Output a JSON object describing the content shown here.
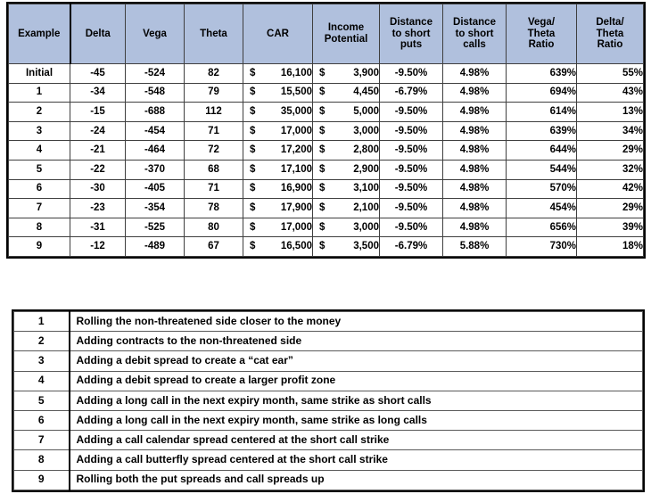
{
  "metrics_table": {
    "headers": [
      "Example",
      "Delta",
      "Vega",
      "Theta",
      "CAR",
      "Income Potential",
      "Distance to short puts",
      "Distance to short calls",
      "Vega/ Theta Ratio",
      "Delta/ Theta Ratio"
    ],
    "header_lines": {
      "example": [
        "Example"
      ],
      "delta": [
        "Delta"
      ],
      "vega": [
        "Vega"
      ],
      "theta": [
        "Theta"
      ],
      "car": [
        "CAR"
      ],
      "income": [
        "Income",
        "Potential"
      ],
      "dist_short_puts": [
        "Distance",
        "to short",
        "puts"
      ],
      "dist_short_calls": [
        "Distance",
        "to short",
        "calls"
      ],
      "vega_theta": [
        "Vega/",
        "Theta",
        "Ratio"
      ],
      "delta_theta": [
        "Delta/",
        "Theta",
        "Ratio"
      ]
    },
    "rows": [
      {
        "example": "Initial",
        "delta": "-45",
        "vega": "-524",
        "theta": "82",
        "car_cur": "$",
        "car": "16,100",
        "income_cur": "$",
        "income": "3,900",
        "dist_short_puts": "-9.50%",
        "dist_short_calls": "4.98%",
        "vega_theta_ratio": "639%",
        "delta_theta_ratio": "55%"
      },
      {
        "example": "1",
        "delta": "-34",
        "vega": "-548",
        "theta": "79",
        "car_cur": "$",
        "car": "15,500",
        "income_cur": "$",
        "income": "4,450",
        "dist_short_puts": "-6.79%",
        "dist_short_calls": "4.98%",
        "vega_theta_ratio": "694%",
        "delta_theta_ratio": "43%"
      },
      {
        "example": "2",
        "delta": "-15",
        "vega": "-688",
        "theta": "112",
        "car_cur": "$",
        "car": "35,000",
        "income_cur": "$",
        "income": "5,000",
        "dist_short_puts": "-9.50%",
        "dist_short_calls": "4.98%",
        "vega_theta_ratio": "614%",
        "delta_theta_ratio": "13%"
      },
      {
        "example": "3",
        "delta": "-24",
        "vega": "-454",
        "theta": "71",
        "car_cur": "$",
        "car": "17,000",
        "income_cur": "$",
        "income": "3,000",
        "dist_short_puts": "-9.50%",
        "dist_short_calls": "4.98%",
        "vega_theta_ratio": "639%",
        "delta_theta_ratio": "34%"
      },
      {
        "example": "4",
        "delta": "-21",
        "vega": "-464",
        "theta": "72",
        "car_cur": "$",
        "car": "17,200",
        "income_cur": "$",
        "income": "2,800",
        "dist_short_puts": "-9.50%",
        "dist_short_calls": "4.98%",
        "vega_theta_ratio": "644%",
        "delta_theta_ratio": "29%"
      },
      {
        "example": "5",
        "delta": "-22",
        "vega": "-370",
        "theta": "68",
        "car_cur": "$",
        "car": "17,100",
        "income_cur": "$",
        "income": "2,900",
        "dist_short_puts": "-9.50%",
        "dist_short_calls": "4.98%",
        "vega_theta_ratio": "544%",
        "delta_theta_ratio": "32%"
      },
      {
        "example": "6",
        "delta": "-30",
        "vega": "-405",
        "theta": "71",
        "car_cur": "$",
        "car": "16,900",
        "income_cur": "$",
        "income": "3,100",
        "dist_short_puts": "-9.50%",
        "dist_short_calls": "4.98%",
        "vega_theta_ratio": "570%",
        "delta_theta_ratio": "42%"
      },
      {
        "example": "7",
        "delta": "-23",
        "vega": "-354",
        "theta": "78",
        "car_cur": "$",
        "car": "17,900",
        "income_cur": "$",
        "income": "2,100",
        "dist_short_puts": "-9.50%",
        "dist_short_calls": "4.98%",
        "vega_theta_ratio": "454%",
        "delta_theta_ratio": "29%"
      },
      {
        "example": "8",
        "delta": "-31",
        "vega": "-525",
        "theta": "80",
        "car_cur": "$",
        "car": "17,000",
        "income_cur": "$",
        "income": "3,000",
        "dist_short_puts": "-9.50%",
        "dist_short_calls": "4.98%",
        "vega_theta_ratio": "656%",
        "delta_theta_ratio": "39%"
      },
      {
        "example": "9",
        "delta": "-12",
        "vega": "-489",
        "theta": "67",
        "car_cur": "$",
        "car": "16,500",
        "income_cur": "$",
        "income": "3,500",
        "dist_short_puts": "-6.79%",
        "dist_short_calls": "5.88%",
        "vega_theta_ratio": "730%",
        "delta_theta_ratio": "18%"
      }
    ]
  },
  "legend_table": {
    "rows": [
      {
        "num": "1",
        "text": "Rolling the non-threatened side closer to the money"
      },
      {
        "num": "2",
        "text": "Adding contracts to the non-threatened side"
      },
      {
        "num": "3",
        "text": "Adding a debit spread to create a “cat ear”"
      },
      {
        "num": "4",
        "text": "Adding a debit spread to create a larger profit zone"
      },
      {
        "num": "5",
        "text": "Adding a long call in the next expiry month, same strike as short calls"
      },
      {
        "num": "6",
        "text": "Adding a long call in the next expiry month, same strike as long calls"
      },
      {
        "num": "7",
        "text": "Adding a call calendar spread centered at the short call strike"
      },
      {
        "num": "8",
        "text": "Adding a call butterfly spread centered at the short call strike"
      },
      {
        "num": "9",
        "text": "Rolling both the put spreads and call spreads up"
      }
    ]
  },
  "colors": {
    "header_fill": "#b0c0dd",
    "grid_line": "#3f3f3f",
    "frame": "#000000",
    "text": "#000000"
  }
}
